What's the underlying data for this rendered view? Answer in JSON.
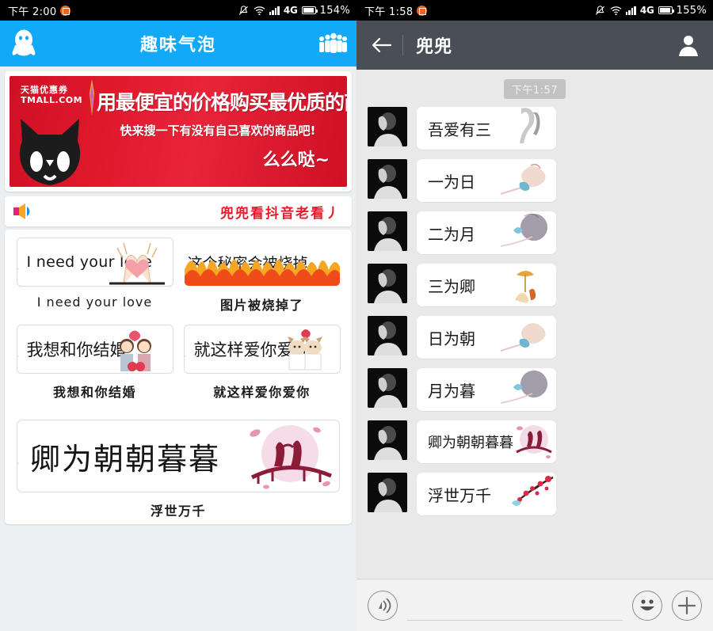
{
  "left": {
    "statusbar": {
      "time": "下午 2:00",
      "network": "4G",
      "battery": "154%",
      "icons": [
        "bell-muted-icon",
        "wifi-icon",
        "signal-bars-icon",
        "battery-icon"
      ]
    },
    "header": {
      "logo": "qq-penguin-logo",
      "title": "趣味气泡",
      "right_icon": "group-people-icon"
    },
    "ad": {
      "brand_cn": "天猫优惠券",
      "brand_en": "TMALL.COM",
      "headline": "用最便宜的价格购买最优质的商品",
      "subline": "快来搜一下有没有自己喜欢的商品吧!",
      "signature": "么么哒~"
    },
    "announcement": {
      "icon": "speaker-icon",
      "text": "兜兜看抖音老看丿"
    },
    "stickers": [
      {
        "bubble": "I need your love",
        "caption": "I need your love",
        "lang": "en"
      },
      {
        "bubble": "这个秘密会被烧掉",
        "caption": "图片被烧掉了",
        "lang": "cn"
      },
      {
        "bubble": "我想和你结婚",
        "caption": "我想和你结婚",
        "lang": "cn"
      },
      {
        "bubble": "就这样爱你爱你",
        "caption": "就这样爱你爱你",
        "lang": "cn"
      }
    ],
    "big_sticker": {
      "bubble": "卿为朝朝暮暮",
      "caption": "浮世万千"
    }
  },
  "right": {
    "statusbar": {
      "time": "下午 1:58",
      "network": "4G",
      "battery": "155%"
    },
    "header": {
      "back_icon": "back-arrow-icon",
      "title": "兜兜",
      "right_icon": "person-profile-icon"
    },
    "timestamp": "下午1:57",
    "messages": [
      {
        "text": "吾爱有三"
      },
      {
        "text": "一为日"
      },
      {
        "text": "二为月"
      },
      {
        "text": "三为卿"
      },
      {
        "text": "日为朝"
      },
      {
        "text": "月为暮"
      },
      {
        "text": "卿为朝朝暮暮"
      },
      {
        "text": "浮世万千"
      }
    ],
    "input": {
      "voice_icon": "voice-record-icon",
      "placeholder": "",
      "value": "",
      "emoji_icon": "smiley-face-icon",
      "plus_icon": "plus-icon"
    }
  },
  "colors": {
    "qq_blue": "#13a9f9",
    "chat_header": "#4a4f57",
    "announce_red": "#e8192c",
    "ad_red": "#d5122a"
  }
}
